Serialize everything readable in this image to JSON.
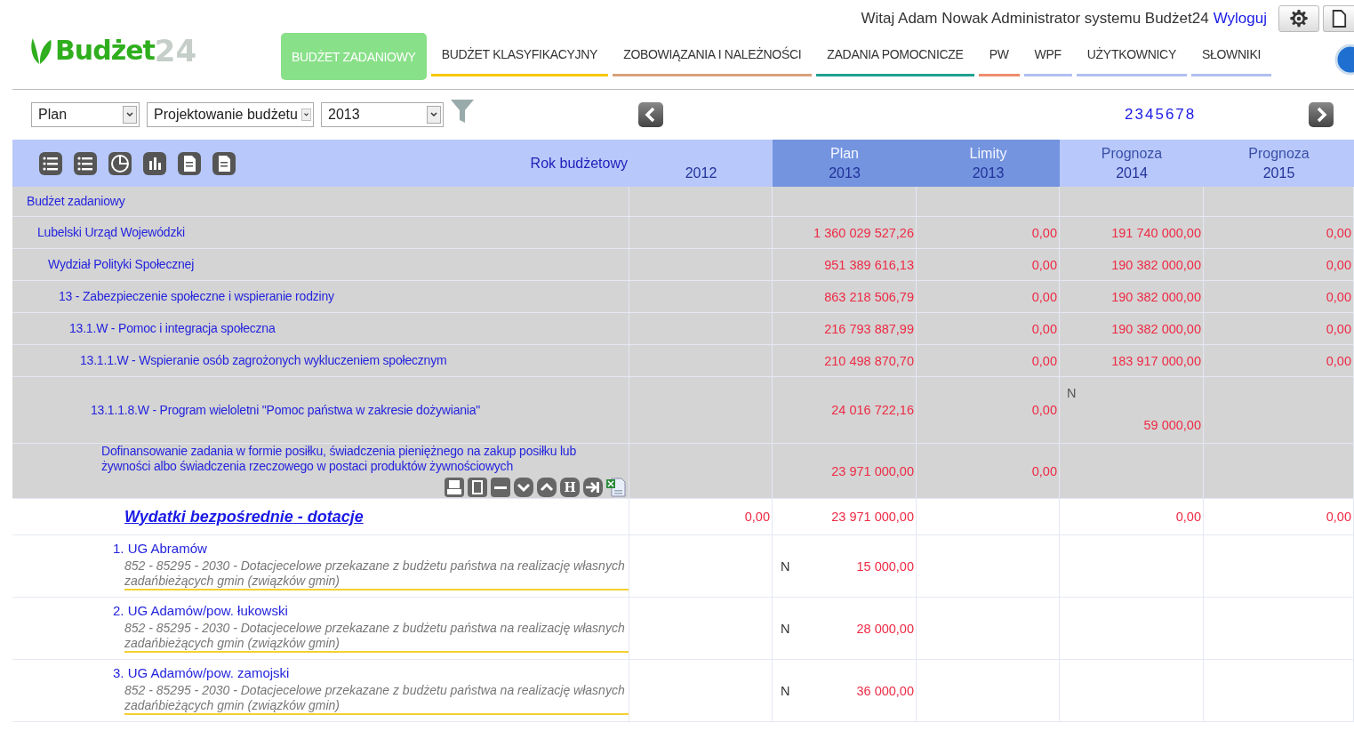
{
  "header": {
    "logo": {
      "main": "Budżet",
      "number": "24"
    },
    "greeting": "Witaj Adam Nowak Administrator systemu Budżet24",
    "logout": "Wyloguj"
  },
  "nav": [
    {
      "label": "BUDŻET ZADANIOWY",
      "selected": true,
      "color": "#88e088"
    },
    {
      "label": "BUDŻET KLASYFIKACYJNY",
      "selected": false,
      "color": "#f5c800"
    },
    {
      "label": "ZOBOWIĄZANIA I NALEŻNOŚCI",
      "selected": false,
      "color": "#d8a27a"
    },
    {
      "label": "ZADANIA POMOCNICZE",
      "selected": false,
      "color": "#20a090"
    },
    {
      "label": "PW",
      "selected": false,
      "color": "#f08c6c"
    },
    {
      "label": "WPF",
      "selected": false,
      "color": "#b0bff0"
    },
    {
      "label": "UŻYTKOWNICY",
      "selected": false,
      "color": "#b0bff0"
    },
    {
      "label": "SŁOWNIKI",
      "selected": false,
      "color": "#b0bff0"
    }
  ],
  "filters": [
    {
      "value": "Plan"
    },
    {
      "value": "Projektowanie budżetu"
    },
    {
      "value": "2013"
    }
  ],
  "pages": [
    "2",
    "3",
    "4",
    "5",
    "6",
    "7",
    "8"
  ],
  "table": {
    "toolbar": [
      {
        "kind": "list"
      },
      {
        "kind": "list"
      },
      {
        "kind": "pie"
      },
      {
        "kind": "bars"
      },
      {
        "kind": "doc"
      },
      {
        "kind": "doc"
      }
    ],
    "year_label": "Rok budżetowy",
    "columns": [
      {
        "year": "2012",
        "kind": "plain"
      },
      {
        "title": "Plan",
        "year": "2013",
        "kind": "current"
      },
      {
        "title": "Limity",
        "year": "2013",
        "kind": "current"
      },
      {
        "title": "Prognoza",
        "year": "2014",
        "kind": "plain"
      },
      {
        "title": "Prognoza",
        "year": "2015",
        "kind": "plain"
      }
    ],
    "tree": [
      {
        "label": "Budżet zadaniowy",
        "cells": [
          null,
          null,
          null,
          null,
          null
        ],
        "children": [
          {
            "label": "Lubelski Urząd Wojewódzki",
            "cells": [
              null,
              "1 360 029 527,26",
              "0,00",
              "191 740 000,00",
              "0,00"
            ],
            "children": [
              {
                "label": "Wydział Polityki Społecznej",
                "cells": [
                  null,
                  "951 389 616,13",
                  "0,00",
                  "190 382 000,00",
                  "0,00"
                ],
                "children": [
                  {
                    "label": "13 - Zabezpieczenie społeczne i wspieranie rodziny",
                    "cells": [
                      null,
                      "863 218 506,79",
                      "0,00",
                      "190 382 000,00",
                      "0,00"
                    ],
                    "children": [
                      {
                        "label": "13.1.W - Pomoc i integracja społeczna",
                        "cells": [
                          null,
                          "216 793 887,99",
                          "0,00",
                          "190 382 000,00",
                          "0,00"
                        ],
                        "children": [
                          {
                            "label": "13.1.1.W - Wspieranie osób zagrożonych wykluczeniem społecznym",
                            "cells": [
                              null,
                              "210 498 870,70",
                              "0,00",
                              "183 917 000,00",
                              "0,00"
                            ],
                            "children": [
                              {
                                "label": "13.1.1.8.W - Program wieloletni \"Pomoc państwa w zakresie dożywiania\"",
                                "cells": [
                                  null,
                                  "24 016 722,16",
                                  "0,00",
                                  {
                                    "mark": "N",
                                    "value": "59 000,00"
                                  },
                                  null
                                ],
                                "children": [
                                  {
                                    "label": "Dofinansowanie zadania w formie posiłku, świadczenia pieniężnego na zakup posiłku lub żywności albo świadczenia rzeczowego w postaci produktów żywnościowych",
                                    "cells": [
                                      null,
                                      "23 971 000,00",
                                      "0,00",
                                      null,
                                      null
                                    ],
                                    "tools": [
                                      {
                                        "kind": "print"
                                      },
                                      {
                                        "kind": "frame"
                                      },
                                      {
                                        "kind": "minus"
                                      },
                                      {
                                        "kind": "down"
                                      },
                                      {
                                        "kind": "up"
                                      },
                                      {
                                        "kind": "letter",
                                        "label": "H"
                                      },
                                      {
                                        "kind": "enter"
                                      },
                                      {
                                        "kind": "excel"
                                      }
                                    ]
                                  }
                                ]
                              }
                            ]
                          }
                        ]
                      }
                    ]
                  }
                ]
              }
            ]
          }
        ]
      }
    ],
    "section": {
      "title": "Wydatki bezpośrednie - dotacje",
      "cells": [
        "0,00",
        "23 971 000,00",
        null,
        "0,00",
        "0,00"
      ],
      "items": [
        {
          "name": "1. UG Abramów",
          "description": "852 - 85295 - 2030 - Dotacjecelowe przekazane z budżetu państwa na realizację własnych zadańbieżących gmin (związków gmin)",
          "cells": [
            null,
            {
              "mark": "N",
              "value": "15 000,00"
            },
            null,
            null,
            null
          ]
        },
        {
          "name": "2. UG Adamów/pow. łukowski",
          "description": "852 - 85295 - 2030 - Dotacjecelowe przekazane z budżetu państwa na realizację własnych zadańbieżących gmin (związków gmin)",
          "cells": [
            null,
            {
              "mark": "N",
              "value": "28 000,00"
            },
            null,
            null,
            null
          ]
        },
        {
          "name": "3. UG Adamów/pow. zamojski",
          "description": "852 - 85295 - 2030 - Dotacjecelowe przekazane z budżetu państwa na realizację własnych zadańbieżących gmin (związków gmin)",
          "cells": [
            null,
            {
              "mark": "N",
              "value": "36 000,00"
            },
            null,
            null,
            null
          ]
        }
      ]
    }
  }
}
